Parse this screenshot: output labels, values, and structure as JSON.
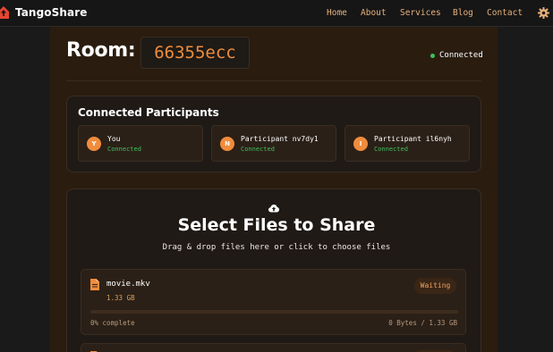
{
  "brand": {
    "name": "TangoShare",
    "logo_icon": "house-upload-icon",
    "accent": "#f08c3c"
  },
  "nav": {
    "items": [
      {
        "label": "Home"
      },
      {
        "label": "About"
      },
      {
        "label": "Services"
      },
      {
        "label": "Blog"
      },
      {
        "label": "Contact"
      }
    ],
    "settings_icon": "gear-icon"
  },
  "room": {
    "title": "Room:",
    "code": "66355ecc",
    "connection_status": "Connected",
    "status_color": "#3fbf5f"
  },
  "participants": {
    "title": "Connected Participants",
    "items": [
      {
        "initial": "Y",
        "name": "You",
        "status": "Connected"
      },
      {
        "initial": "N",
        "name": "Participant nv7dy1",
        "status": "Connected"
      },
      {
        "initial": "I",
        "name": "Participant il6nyh",
        "status": "Connected"
      }
    ]
  },
  "upload": {
    "icon": "cloud-upload-icon",
    "title": "Select Files to Share",
    "subtitle": "Drag & drop files here or click to choose files"
  },
  "files": [
    {
      "icon": "file-icon",
      "name": "movie.mkv",
      "size": "1.33 GB",
      "status": "Waiting",
      "progress_fraction": 0,
      "progress_label": "0% complete",
      "bytes_label": "0 Bytes / 1.33 GB"
    }
  ]
}
